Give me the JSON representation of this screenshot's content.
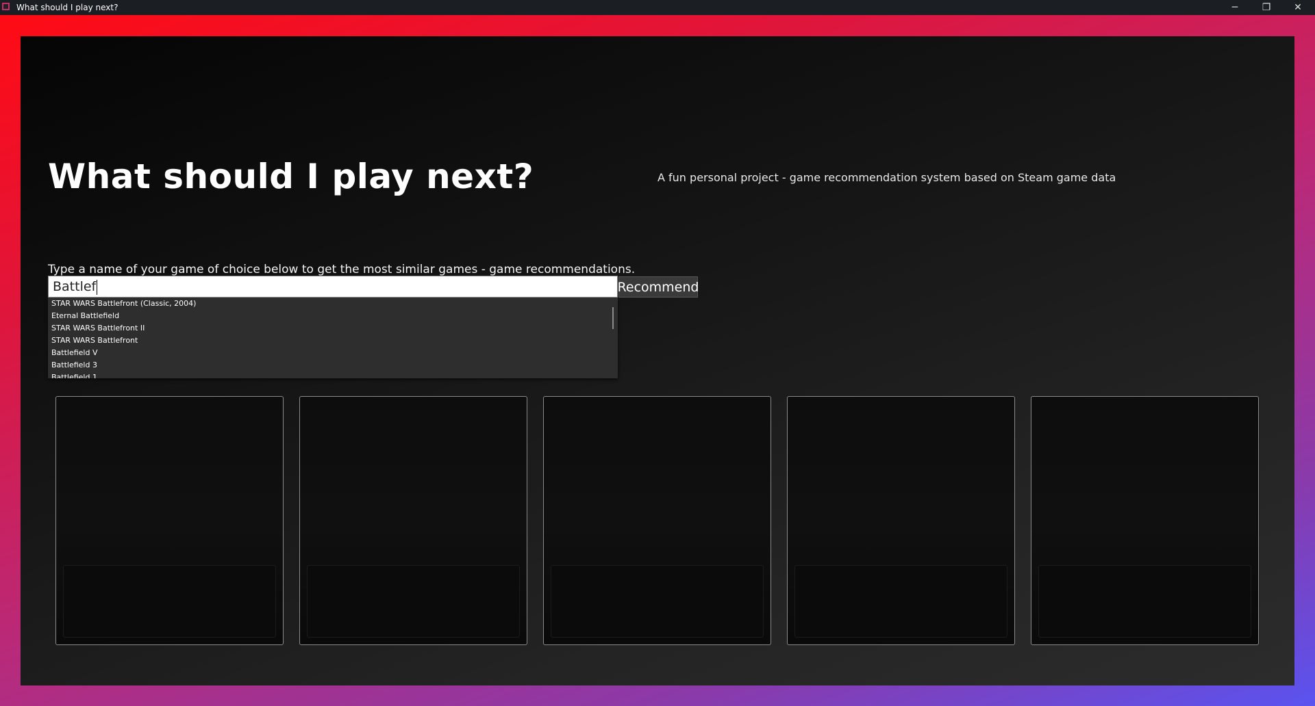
{
  "window": {
    "title": "What should I play next?",
    "controls": {
      "minimize": "─",
      "maximize": "❐",
      "close": "✕"
    }
  },
  "header": {
    "title": "What should I play next?",
    "subtitle": "A fun personal project - game recommendation system based on Steam game data"
  },
  "search": {
    "instructions": "Type a name of your game of choice below to get the most similar games - game recommendations.",
    "value": "Battlef",
    "button_label": "Recommend",
    "suggestions": [
      "STAR WARS Battlefront (Classic, 2004)",
      "Eternal Battlefield",
      "STAR WARS Battlefront II",
      "STAR WARS Battlefront",
      "Battlefield V",
      "Battlefield 3",
      "Battlefield 1"
    ]
  },
  "colors": {
    "frame_start": "#ff0b14",
    "frame_end": "#5a53f0",
    "background": "#151515",
    "card_border": "#8a8a8a"
  }
}
